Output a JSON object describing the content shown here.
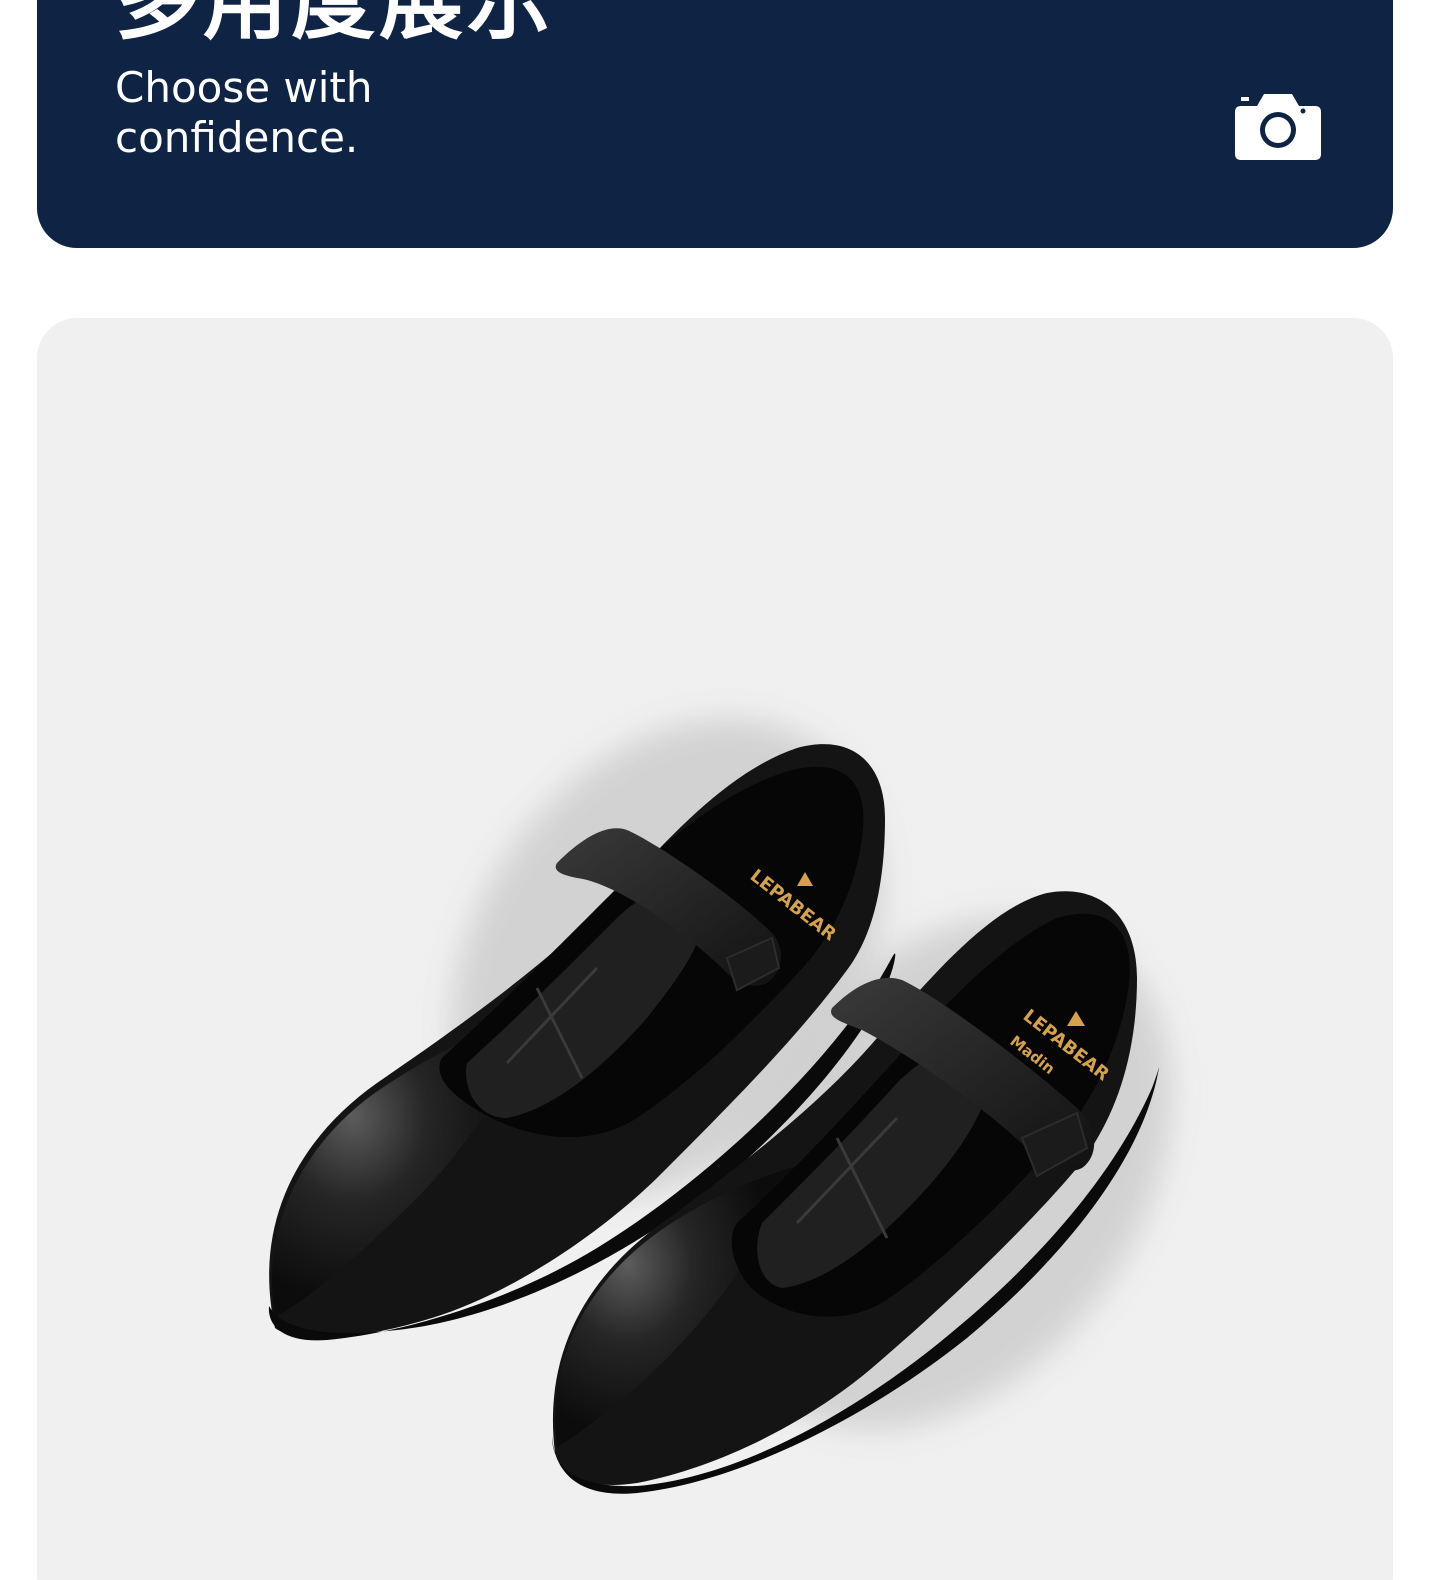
{
  "banner": {
    "title": "多用度展示",
    "subtitle_line1": "Choose with",
    "subtitle_line2": "confidence.",
    "icon": "camera-icon",
    "background_color": "#0f2445",
    "text_color": "#ffffff"
  },
  "photo": {
    "background_color": "#f0f0f0",
    "insole_brand": "LEPABEAR",
    "insole_subtext": "Madin"
  }
}
